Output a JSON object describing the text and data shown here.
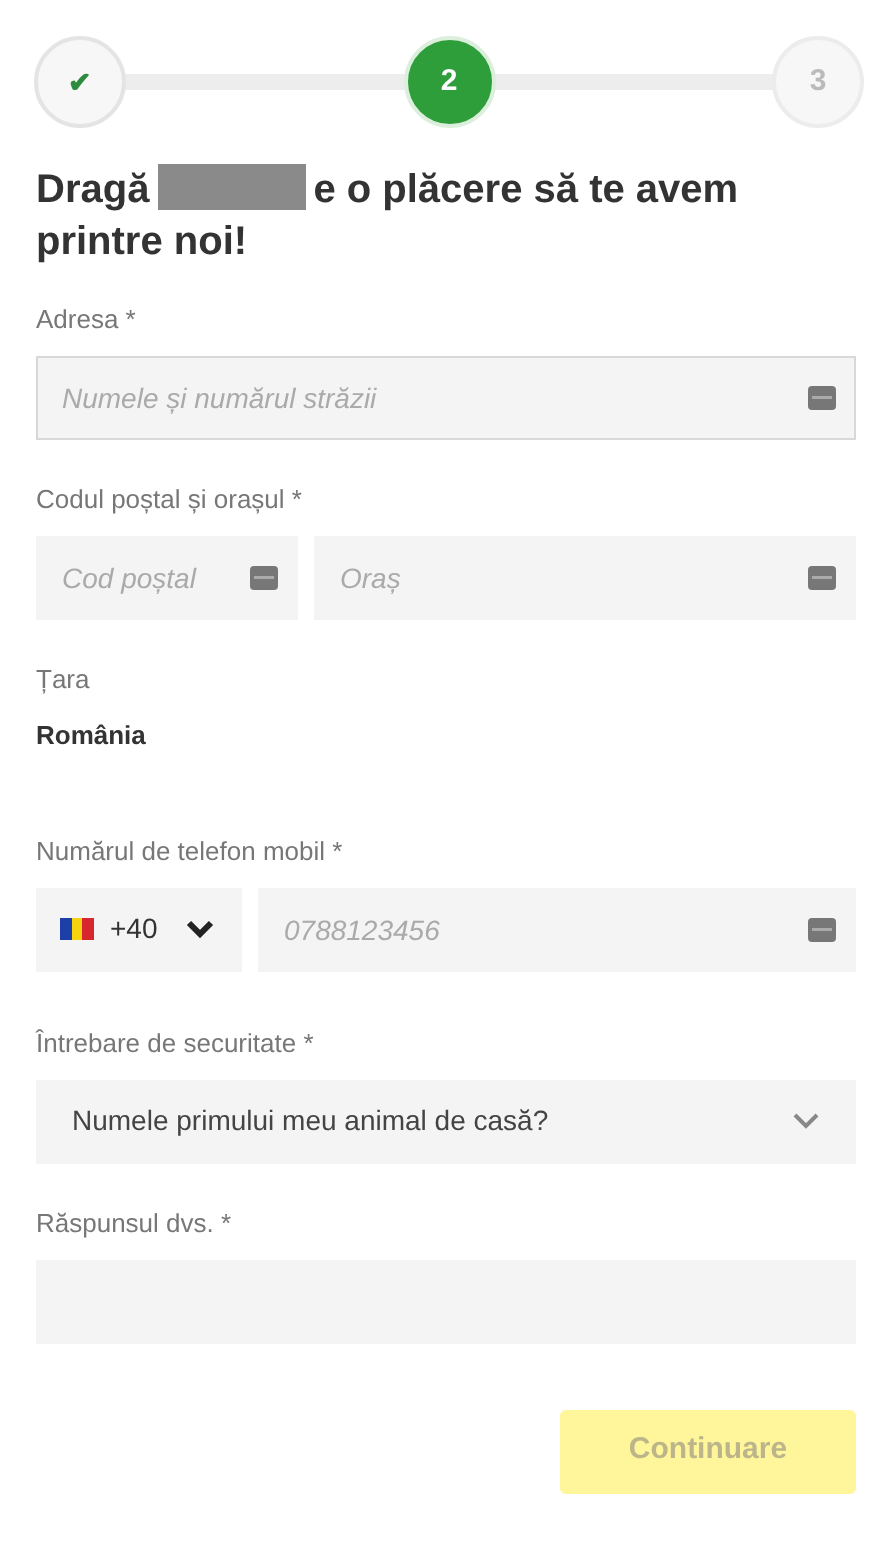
{
  "steps": [
    {
      "label": "✔",
      "completed": true,
      "selected": false
    },
    {
      "label": "2",
      "completed": false,
      "selected": true
    },
    {
      "label": "3",
      "completed": false,
      "selected": false
    }
  ],
  "heading": {
    "before": "Dragă",
    "lines": [
      "e o plăcere să te avem",
      "printre noi!"
    ],
    "name_redacted": true
  },
  "address": {
    "label": "Adresa *",
    "placeholder": "Numele și numărul străzii",
    "focused": true
  },
  "postal": {
    "label": "Codul poștal și orașul *",
    "fields": [
      {
        "placeholder": "Cod poștal"
      },
      {
        "placeholder": "Oraș"
      }
    ]
  },
  "country": {
    "label": "Țara",
    "value": "România"
  },
  "phone": {
    "label": "Numărul de telefon mobil *",
    "prefix": "+40",
    "placeholder": "0788123456"
  },
  "question": {
    "label": "Întrebare de securitate *",
    "value": "Numele primului meu animal de casă?"
  },
  "answer": {
    "label": "Răspunsul dvs. *"
  },
  "continue_button": {
    "label": "Continuare",
    "disabled": true
  }
}
